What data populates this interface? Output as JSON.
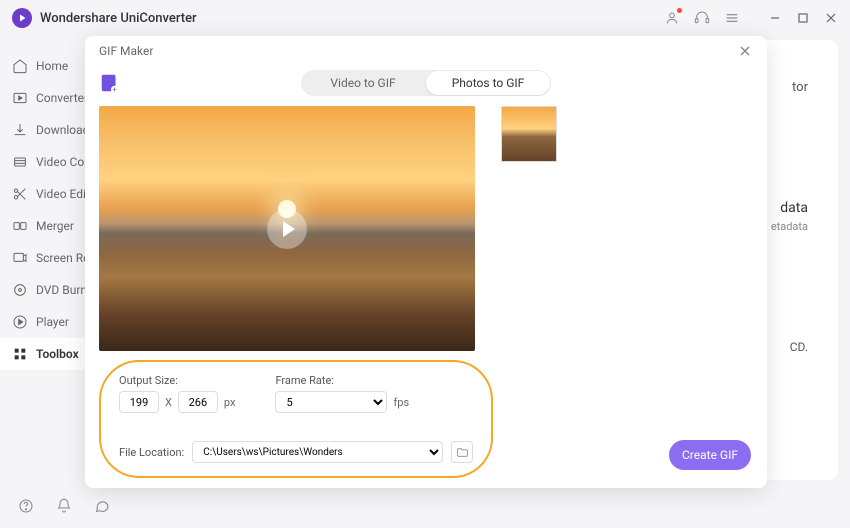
{
  "app": {
    "title": "Wondershare UniConverter"
  },
  "sidebar": {
    "items": [
      {
        "label": "Home"
      },
      {
        "label": "Converter"
      },
      {
        "label": "Downloader"
      },
      {
        "label": "Video Compressor"
      },
      {
        "label": "Video Editor"
      },
      {
        "label": "Merger"
      },
      {
        "label": "Screen Recorder"
      },
      {
        "label": "DVD Burner"
      },
      {
        "label": "Player"
      },
      {
        "label": "Toolbox"
      }
    ]
  },
  "content": {
    "hint_tr": "tor",
    "hint_data": "data",
    "hint_etadata": "etadata",
    "hint_cd": "CD."
  },
  "gif_modal": {
    "title": "GIF Maker",
    "tab_video": "Video to GIF",
    "tab_photos": "Photos to GIF",
    "output_size_label": "Output Size:",
    "width": "199",
    "height": "266",
    "x": "X",
    "px": "px",
    "frame_rate_label": "Frame Rate:",
    "frame_rate_value": "5",
    "fps": "fps",
    "file_location_label": "File Location:",
    "file_location_value": "C:\\Users\\ws\\Pictures\\Wonders",
    "create_button": "Create GIF"
  }
}
